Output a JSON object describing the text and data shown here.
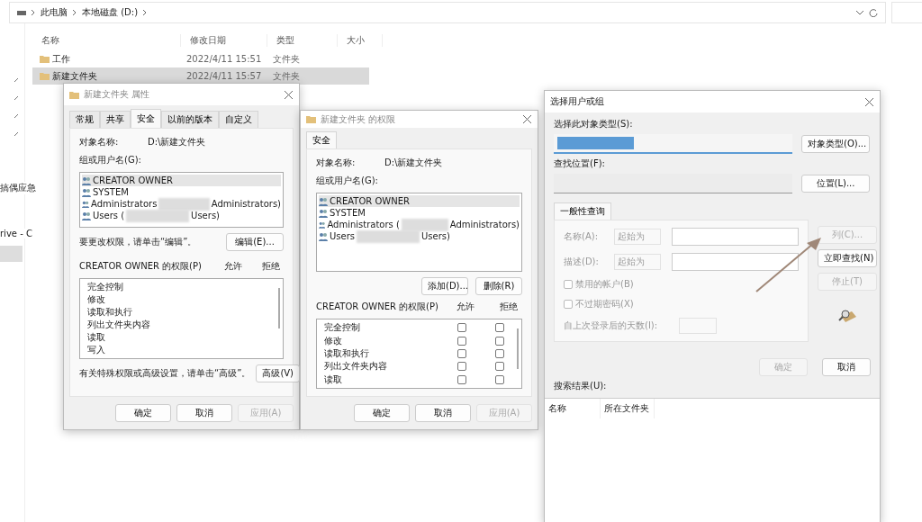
{
  "explorer": {
    "breadcrumb": [
      "此电脑",
      "本地磁盘 (D:)"
    ],
    "nav_items": [
      "搞偶应急",
      "rive - C"
    ],
    "columns": [
      "名称",
      "修改日期",
      "类型",
      "大小"
    ],
    "rows": [
      {
        "name": "工作",
        "modified": "2022/4/11 15:51",
        "type": "文件夹",
        "selected": false
      },
      {
        "name": "新建文件夹",
        "modified": "2022/4/11 15:57",
        "type": "文件夹",
        "selected": true
      }
    ]
  },
  "properties_dialog": {
    "title": "新建文件夹 属性",
    "tabs": [
      {
        "label": "常规",
        "selected": false
      },
      {
        "label": "共享",
        "selected": false
      },
      {
        "label": "安全",
        "selected": true
      },
      {
        "label": "以前的版本",
        "selected": false
      },
      {
        "label": "自定义",
        "selected": false
      }
    ],
    "object_label": "对象名称:",
    "object_value": "D:\\新建文件夹",
    "groups_label": "组或用户名(G):",
    "users": [
      {
        "name": "CREATOR OWNER",
        "redacted": false,
        "selected": true
      },
      {
        "name": "SYSTEM",
        "redacted": false,
        "selected": false
      },
      {
        "name": "Administrators",
        "suffix": "Administrators)",
        "redacted": true,
        "selected": false
      },
      {
        "name": "Users (",
        "suffix": "Users)",
        "redacted": true,
        "selected": false
      }
    ],
    "edit_hint": "要更改权限，请单击“编辑”。",
    "edit_button": "编辑(E)...",
    "permissions_label": "CREATOR OWNER 的权限(P)",
    "allow_label": "允许",
    "deny_label": "拒绝",
    "permissions": [
      "完全控制",
      "修改",
      "读取和执行",
      "列出文件夹内容",
      "读取",
      "写入"
    ],
    "advanced_hint": "有关特殊权限或高级设置，请单击“高级”。",
    "advanced_button": "高级(V)",
    "buttons": [
      {
        "label": "确定",
        "disabled": false
      },
      {
        "label": "取消",
        "disabled": false
      },
      {
        "label": "应用(A)",
        "disabled": true
      }
    ]
  },
  "permissions_dialog": {
    "title": "新建文件夹 的权限",
    "tabs": [
      {
        "label": "安全",
        "selected": true
      }
    ],
    "object_label": "对象名称:",
    "object_value": "D:\\新建文件夹",
    "groups_label": "组或用户名(G):",
    "users": [
      {
        "name": "CREATOR OWNER",
        "redacted": false,
        "selected": true
      },
      {
        "name": "SYSTEM",
        "redacted": false,
        "selected": false
      },
      {
        "name": "Administrators (",
        "suffix": "Administrators)",
        "redacted": true,
        "selected": false
      },
      {
        "name": "Users",
        "suffix": "Users)",
        "redacted": true,
        "selected": false
      }
    ],
    "add_button": "添加(D)...",
    "remove_button": "删除(R)",
    "permissions_label": "CREATOR OWNER 的权限(P)",
    "allow_label": "允许",
    "deny_label": "拒绝",
    "permissions": [
      {
        "name": "完全控制",
        "allow": false,
        "deny": false
      },
      {
        "name": "修改",
        "allow": false,
        "deny": false
      },
      {
        "name": "读取和执行",
        "allow": false,
        "deny": false
      },
      {
        "name": "列出文件夹内容",
        "allow": false,
        "deny": false
      },
      {
        "name": "读取",
        "allow": false,
        "deny": false
      }
    ],
    "buttons": [
      {
        "label": "确定",
        "disabled": false
      },
      {
        "label": "取消",
        "disabled": false
      },
      {
        "label": "应用(A)",
        "disabled": true
      }
    ]
  },
  "select_dialog": {
    "title": "选择用户或组",
    "object_type_label": "选择此对象类型(S):",
    "object_type_button": "对象类型(O)...",
    "location_label": "查找位置(F):",
    "location_button": "位置(L)...",
    "query_tab": "一般性查询",
    "name_label": "名称(A):",
    "name_mode": "起始为",
    "desc_label": "描述(D):",
    "desc_mode": "起始为",
    "checkboxes": [
      {
        "label": "禁用的帐户(B)",
        "checked": false
      },
      {
        "label": "不过期密码(X)",
        "checked": false
      }
    ],
    "days_label": "自上次登录后的天数(I):",
    "side_buttons": [
      {
        "label": "列(C)...",
        "disabled": true
      },
      {
        "label": "立即查找(N)",
        "disabled": false
      },
      {
        "label": "停止(T)",
        "disabled": true
      }
    ],
    "buttons": [
      {
        "label": "确定",
        "disabled": true
      },
      {
        "label": "取消",
        "disabled": false
      }
    ],
    "results_label": "搜索结果(U):",
    "result_columns": [
      "名称",
      "所在文件夹"
    ]
  }
}
